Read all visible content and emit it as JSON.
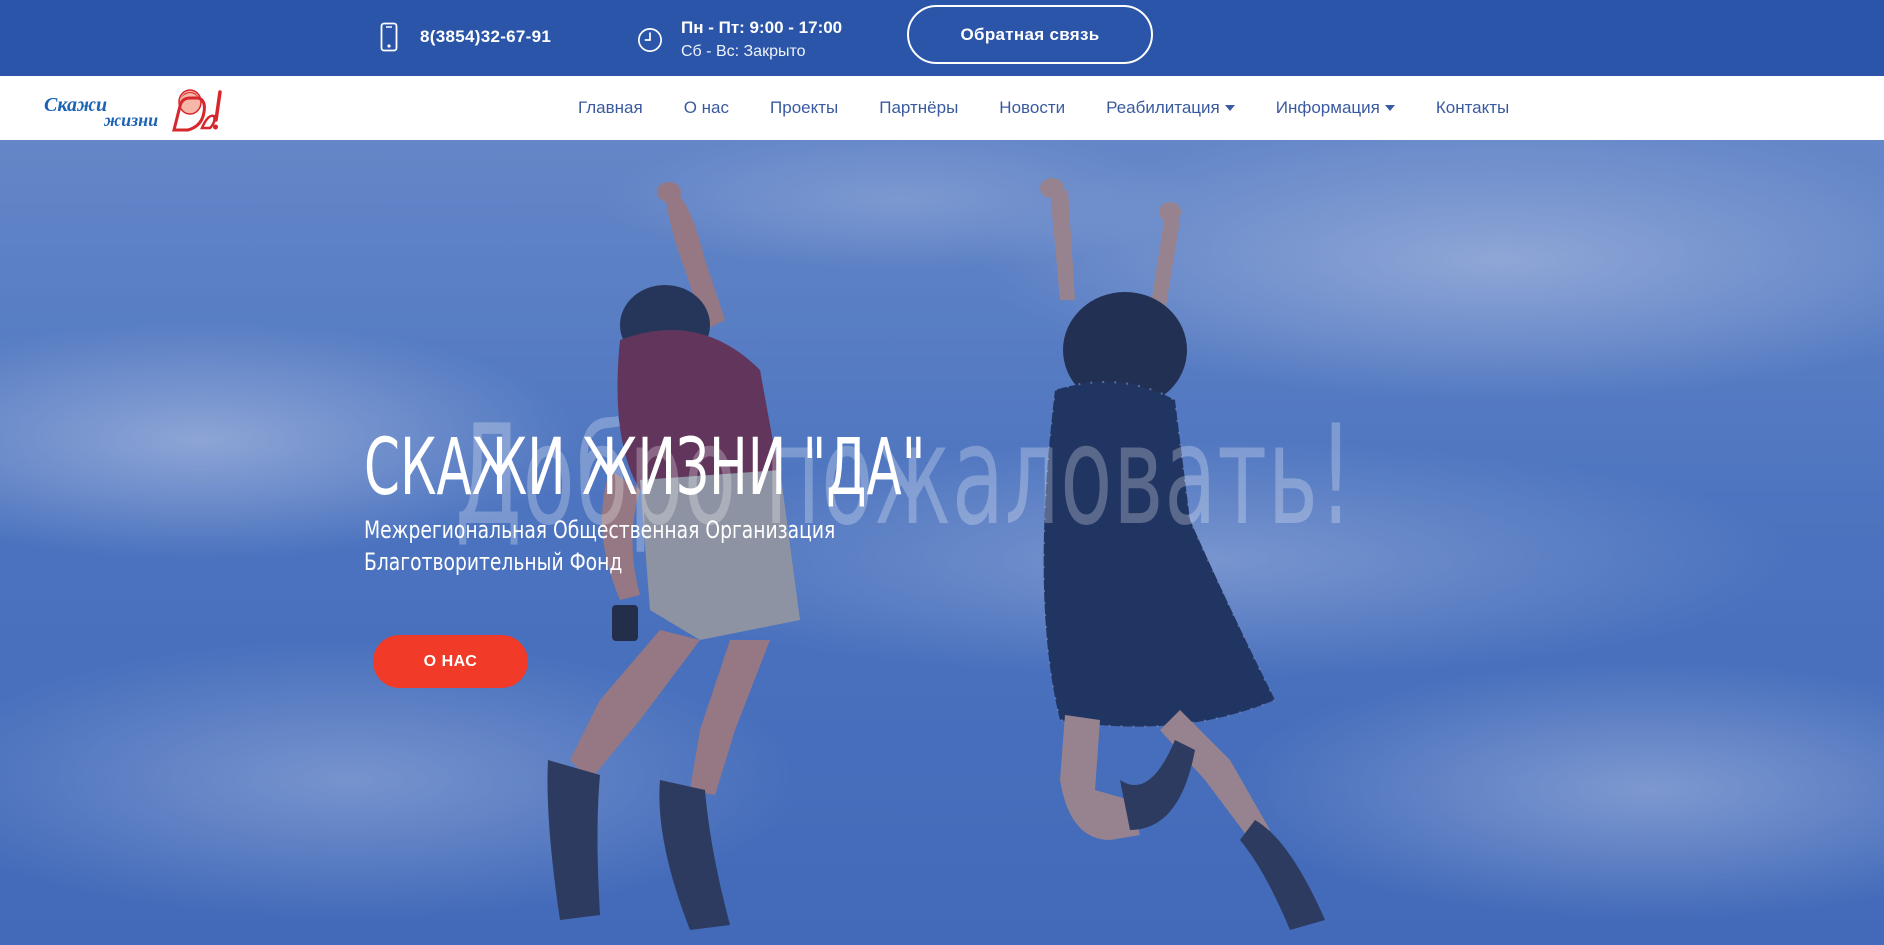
{
  "topbar": {
    "phone": "8(3854)32-67-91",
    "hours_main": "Пн - Пт: 9:00 - 17:00",
    "hours_weekend": "Сб - Вс: Закрыто",
    "feedback_label": "Обратная связь",
    "icons": {
      "phone": "phone-icon",
      "clock": "clock-icon"
    }
  },
  "logo": {
    "word1": "Скажи",
    "word2": "жизни",
    "word3": "Да!"
  },
  "nav": {
    "items": [
      {
        "label": "Главная"
      },
      {
        "label": "О нас"
      },
      {
        "label": "Проекты"
      },
      {
        "label": "Партнёры"
      },
      {
        "label": "Новости"
      },
      {
        "label": "Реабилитация",
        "dropdown": true
      },
      {
        "label": "Информация",
        "dropdown": true
      },
      {
        "label": "Контакты"
      }
    ]
  },
  "hero": {
    "watermark": "Добро пожаловать!",
    "title": "СКАЖИ ЖИЗНИ \"ДА\"",
    "subtitle_line1": "Межрегиональная Общественная Организация",
    "subtitle_line2": "Благотворительный Фонд",
    "button_label": "О НАС"
  },
  "colors": {
    "topbar_bg": "#2b55a8",
    "nav_link": "#3a5aa0",
    "hero_overlay": "#2850aa",
    "cta_button": "#f13a28",
    "logo_blue": "#1d63b5",
    "logo_red": "#d8262d"
  }
}
